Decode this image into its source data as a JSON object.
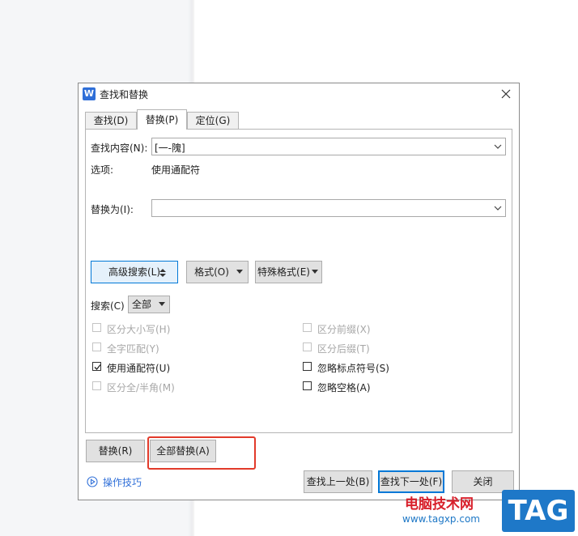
{
  "dialog": {
    "title": "查找和替换",
    "app_icon_letter": "W"
  },
  "tabs": [
    {
      "label": "查找(D)"
    },
    {
      "label": "替换(P)"
    },
    {
      "label": "定位(G)"
    }
  ],
  "find": {
    "label": "查找内容(N):",
    "value": "[一-隗]"
  },
  "options": {
    "label": "选项:",
    "value": "使用通配符"
  },
  "replace": {
    "label": "替换为(I):",
    "value": ""
  },
  "buttons": {
    "advanced": "高级搜索(L)",
    "format": "格式(O)",
    "special": "特殊格式(E)",
    "replace": "替换(R)",
    "replace_all": "全部替换(A)",
    "find_prev": "查找上一处(B)",
    "find_next": "查找下一处(F)",
    "close": "关闭"
  },
  "search": {
    "label": "搜索(C)",
    "value": "全部"
  },
  "checkboxes_left": [
    {
      "label": "区分大小写(H)",
      "checked": false,
      "enabled": false
    },
    {
      "label": "全字匹配(Y)",
      "checked": false,
      "enabled": false
    },
    {
      "label": "使用通配符(U)",
      "checked": true,
      "enabled": true
    },
    {
      "label": "区分全/半角(M)",
      "checked": false,
      "enabled": false
    }
  ],
  "checkboxes_right": [
    {
      "label": "区分前缀(X)",
      "checked": false,
      "enabled": false
    },
    {
      "label": "区分后缀(T)",
      "checked": false,
      "enabled": false
    },
    {
      "label": "忽略标点符号(S)",
      "checked": false,
      "enabled": true
    },
    {
      "label": "忽略空格(A)",
      "checked": false,
      "enabled": true
    }
  ],
  "tips": {
    "label": "操作技巧"
  },
  "watermark": {
    "text": "电脑技术网",
    "url": "www.tagxp.com",
    "tag": "TAG"
  },
  "colors": {
    "accent": "#0078d7",
    "highlight_box": "#e23a2a",
    "link": "#2f6fd8"
  }
}
